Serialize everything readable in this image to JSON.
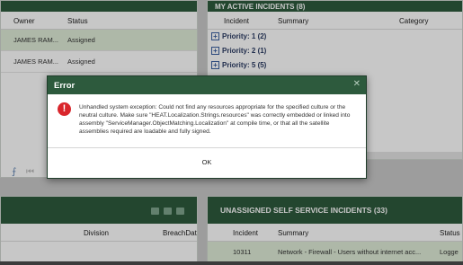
{
  "left_top_panel": {
    "columns": [
      "Owner",
      "Status"
    ],
    "rows": [
      {
        "owner": "JAMES RAM...",
        "status": "Assigned"
      },
      {
        "owner": "JAMES RAM...",
        "status": "Assigned"
      }
    ]
  },
  "right_top_panel": {
    "title": "MY ACTIVE INCIDENTS (8)",
    "columns": [
      "Incident",
      "Summary",
      "Category"
    ],
    "groups": [
      "Priority: 1 (2)",
      "Priority: 2 (1)",
      "Priority: 5 (5)"
    ]
  },
  "left_bottom_panel": {
    "columns": [
      "Division",
      "BreachDat"
    ]
  },
  "right_bottom_panel": {
    "title": "UNASSIGNED SELF SERVICE INCIDENTS (33)",
    "columns": [
      "Incident",
      "Summary",
      "Status"
    ],
    "rows": [
      {
        "incident": "10311",
        "summary": "Network - Firewall - Users without internet acc...",
        "status": "Logge"
      }
    ]
  },
  "dialog": {
    "title": "Error",
    "message": "Unhandled system exception: Could not find any resources appropriate for the specified culture or the neutral culture. Make sure \"HEAT.Localization.Strings.resources\" was correctly embedded or linked into assembly \"ServiceManager.ObjectMatching.Localization\" at compile time, or that all the satellite assemblies required are loadable and fully signed.",
    "ok_label": "OK"
  },
  "icons": {
    "error": "error-icon",
    "close": "close-icon",
    "expand": "plus-icon",
    "first_page": "first-page-icon",
    "prev_page": "prev-page-icon"
  },
  "colors": {
    "header_green": "#2d5a3d",
    "row_highlight": "#dfecd8",
    "error_red": "#d9262c"
  }
}
